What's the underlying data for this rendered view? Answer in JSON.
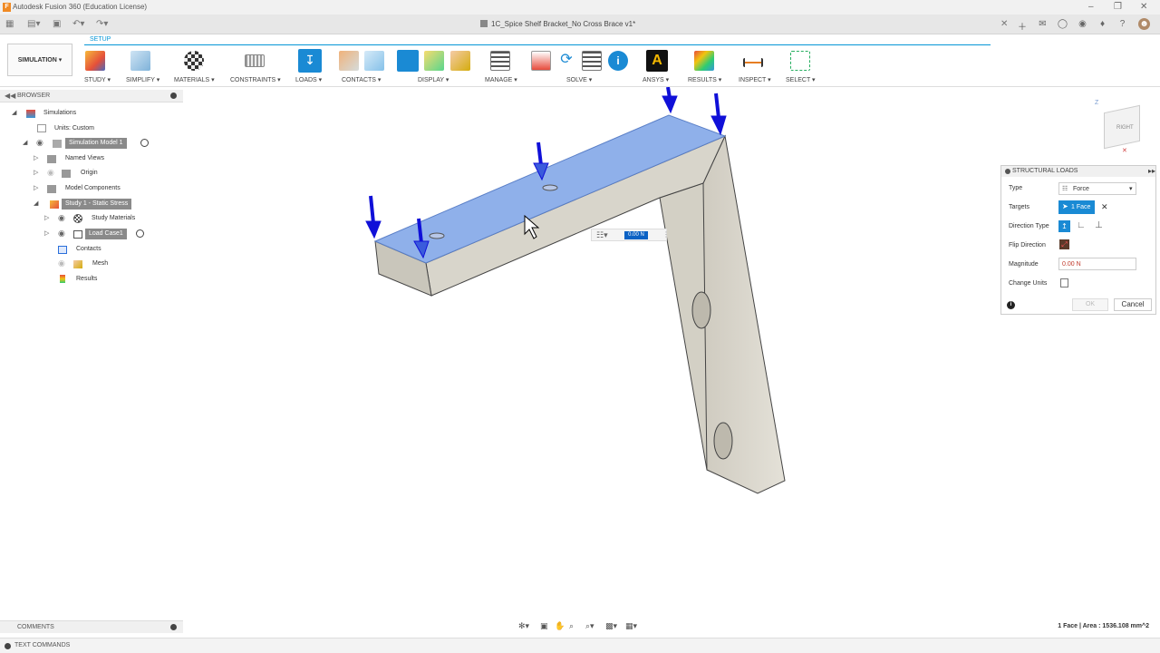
{
  "app": {
    "title": "Autodesk Fusion 360 (Education License)",
    "document_tab": "1C_Spice Shelf Bracket_No Cross Brace v1*"
  },
  "ribbon": {
    "workspace": "SIMULATION ▾",
    "active_tab": "SETUP",
    "groups": [
      {
        "label": "STUDY ▾"
      },
      {
        "label": "SIMPLIFY ▾"
      },
      {
        "label": "MATERIALS ▾"
      },
      {
        "label": "CONSTRAINTS ▾"
      },
      {
        "label": "LOADS ▾"
      },
      {
        "label": "CONTACTS ▾"
      },
      {
        "label": "DISPLAY ▾"
      },
      {
        "label": "MANAGE ▾"
      },
      {
        "label": "SOLVE ▾"
      },
      {
        "label": "ANSYS ▾"
      },
      {
        "label": "RESULTS ▾"
      },
      {
        "label": "INSPECT ▾"
      },
      {
        "label": "SELECT ▾"
      }
    ]
  },
  "browser": {
    "title": "BROWSER",
    "items": [
      {
        "label": "Simulations"
      },
      {
        "label": "Units: Custom"
      },
      {
        "label": "Simulation Model 1"
      },
      {
        "label": "Named Views"
      },
      {
        "label": "Origin"
      },
      {
        "label": "Model Components"
      },
      {
        "label": "Study 1 - Static Stress"
      },
      {
        "label": "Study Materials"
      },
      {
        "label": "Load Case1"
      },
      {
        "label": "Contacts"
      },
      {
        "label": "Mesh"
      },
      {
        "label": "Results"
      }
    ]
  },
  "canvas": {
    "inline_input_value": "0.00 N",
    "viewcube_label": "RIGHT",
    "viewcube_axis": "Z"
  },
  "structural_loads": {
    "title": "STRUCTURAL LOADS",
    "type_label": "Type",
    "type_value": "Force",
    "targets_label": "Targets",
    "targets_value": "1 Face",
    "direction_type_label": "Direction Type",
    "flip_direction_label": "Flip Direction",
    "magnitude_label": "Magnitude",
    "magnitude_value": "0.00 N",
    "change_units_label": "Change Units",
    "ok_label": "OK",
    "cancel_label": "Cancel"
  },
  "bottom": {
    "comments": "COMMENTS",
    "text_commands": "TEXT COMMANDS",
    "status": "1 Face | Area : 1536.108 mm^2"
  },
  "colors": {
    "accent": "#0696d7",
    "load_arrow": "#1010d8",
    "face_highlight": "#8fb0ea",
    "body": "#dad7cd"
  }
}
